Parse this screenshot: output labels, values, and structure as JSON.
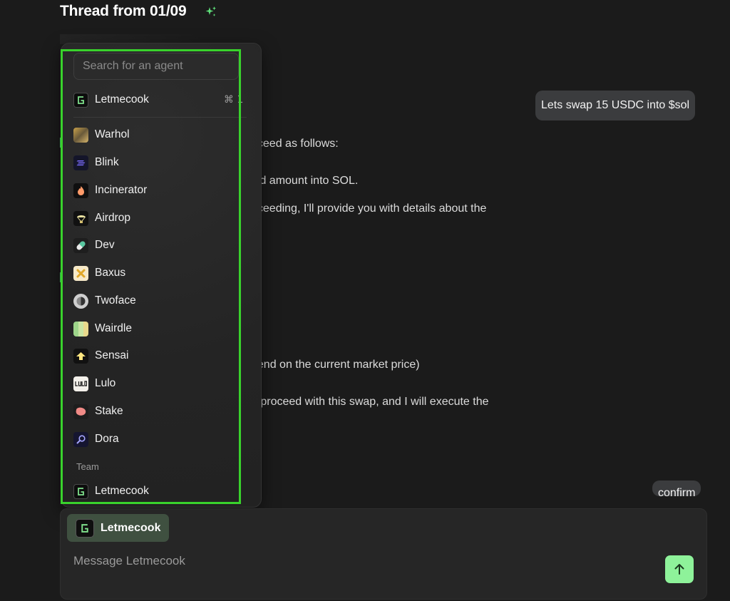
{
  "thread": {
    "title": "Thread from 01/09"
  },
  "messages": {
    "user_1": "Lets swap 15 USDC into $sol",
    "user_2": "confirm",
    "assistant_lines": [
      "oceed as follows:",
      "ied amount into SOL.",
      "oceeding, I'll provide you with details about the",
      "pend on the current market price)",
      "o proceed with this swap, and I will execute the"
    ]
  },
  "agent_menu": {
    "search_placeholder": "Search for an agent",
    "current": {
      "label": "Letmecook",
      "shortcut": "⌘ 1",
      "icon": "letmecook-icon"
    },
    "agents": [
      {
        "label": "Warhol",
        "icon": "warhol-icon"
      },
      {
        "label": "Blink",
        "icon": "blink-icon"
      },
      {
        "label": "Incinerator",
        "icon": "incinerator-icon"
      },
      {
        "label": "Airdrop",
        "icon": "airdrop-icon"
      },
      {
        "label": "Dev",
        "icon": "dev-icon"
      },
      {
        "label": "Baxus",
        "icon": "baxus-icon"
      },
      {
        "label": "Twoface",
        "icon": "twoface-icon"
      },
      {
        "label": "Wairdle",
        "icon": "wairdle-icon"
      },
      {
        "label": "Sensai",
        "icon": "sensai-icon"
      },
      {
        "label": "Lulo",
        "icon": "lulo-icon"
      },
      {
        "label": "Stake",
        "icon": "stake-icon"
      },
      {
        "label": "Dora",
        "icon": "dora-icon"
      }
    ],
    "team_section_label": "Team",
    "team": [
      {
        "label": "Letmecook",
        "icon": "letmecook-icon"
      }
    ]
  },
  "composer": {
    "selected_agent": "Letmecook",
    "placeholder": "Message Letmecook",
    "send_icon": "arrow-up-icon"
  },
  "colors": {
    "background": "#1b1b1b",
    "highlight": "#39d22c",
    "send_button": "#8ef29a",
    "chip": "#3f5040"
  }
}
